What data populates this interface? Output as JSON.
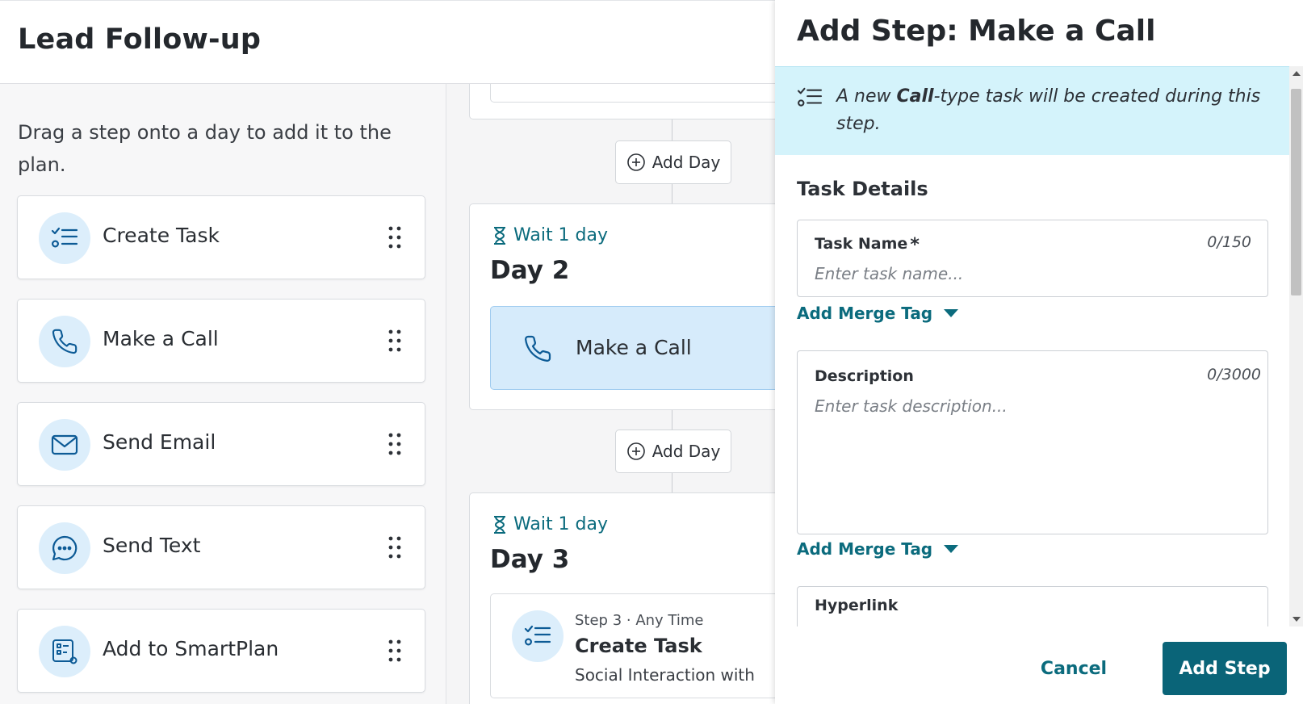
{
  "header": {
    "title": "Lead Follow-up"
  },
  "palette": {
    "hint": "Drag a step onto a day to add it to the plan.",
    "items": [
      {
        "label": "Create Task",
        "icon": "task-list-icon"
      },
      {
        "label": "Make a Call",
        "icon": "phone-icon"
      },
      {
        "label": "Send Email",
        "icon": "envelope-icon"
      },
      {
        "label": "Send Text",
        "icon": "chat-bubble-icon"
      },
      {
        "label": "Add to SmartPlan",
        "icon": "smartplan-icon"
      }
    ]
  },
  "canvas": {
    "add_day_label": "Add Day",
    "days": [
      {
        "wait": "Wait 1 day",
        "title": "Day 2",
        "placed_step": "Make a Call"
      },
      {
        "wait": "Wait 1 day",
        "title": "Day 3",
        "step": {
          "meta": "Step 3 · Any Time",
          "title": "Create Task",
          "subtitle": "Social Interaction with"
        }
      }
    ]
  },
  "panel": {
    "title": "Add Step: Make a Call",
    "banner": {
      "prefix": "A new ",
      "emphasis": "Call",
      "suffix": "-type task will be created during this step."
    },
    "section_title": "Task Details",
    "task_name": {
      "label": "Task Name",
      "required_mark": "*",
      "counter": "0/150",
      "placeholder": "Enter task name...",
      "value": ""
    },
    "merge_tag_label": "Add Merge Tag",
    "description": {
      "label": "Description",
      "counter": "0/3000",
      "placeholder": "Enter task description...",
      "value": ""
    },
    "hyperlink": {
      "label": "Hyperlink"
    },
    "cancel_label": "Cancel",
    "submit_label": "Add Step"
  },
  "colors": {
    "accent": "#0a6478",
    "link": "#0b6b7d",
    "icon_bg": "#dceefb",
    "banner_bg": "#d4f3fb",
    "selected_step_bg": "#d6ebfb"
  }
}
